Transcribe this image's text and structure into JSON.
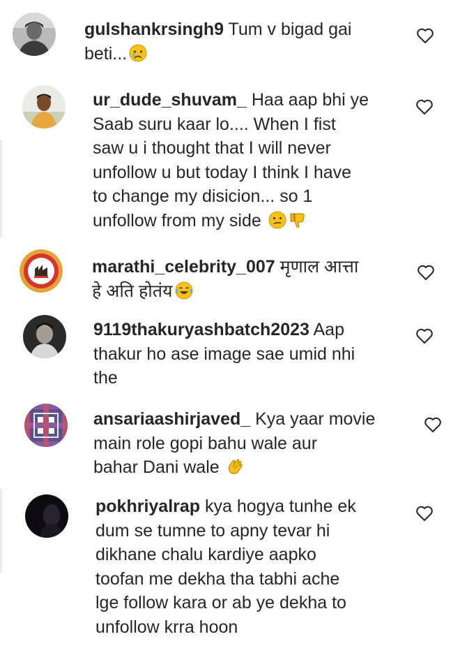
{
  "comments": [
    {
      "username": "gulshankrsingh9",
      "lines": [
        " Tum v bigad gai",
        "beti..."
      ],
      "emojis": [
        "crying-face-icon"
      ]
    },
    {
      "username": "ur_dude_shuvam_",
      "lines": [
        " Haa aap bhi ye",
        "Saab suru kaar lo.... When I fist",
        "saw u i thought that I will never",
        "unfollow u but today I think I have",
        "to change my disicion... so 1",
        "unfollow from my side "
      ],
      "emojis": [
        "confused-face-icon",
        "thumbs-down-icon"
      ]
    },
    {
      "username": "marathi_celebrity_007",
      "lines": [
        " मृणाल आत्ता",
        "हे अति होतंय"
      ],
      "emojis": [
        "tears-of-joy-icon"
      ]
    },
    {
      "username": "9119thakuryashbatch2023",
      "lines": [
        " Aap",
        "thakur ho ase image sae umid nhi",
        "the"
      ],
      "emojis": []
    },
    {
      "username": "ansariaashirjaved_",
      "lines": [
        " Kya yaar movie",
        "main role gopi bahu wale aur",
        "bahar Dani wale "
      ],
      "emojis": [
        "clapping-hands-icon"
      ]
    },
    {
      "username": "pokhriyalrap",
      "lines": [
        " kya hogya tunhe ek",
        "dum se tumne to apny tevar hi",
        "dikhane chalu kardiye aapko",
        "toofan me dekha tha tabhi ache",
        "lge follow kara or ab ye dekha to",
        "unfollow krra hoon"
      ],
      "emojis": []
    }
  ],
  "colors": {
    "text": "#262626",
    "heart_stroke": "#262626",
    "emoji_yellow": "#f6c21a",
    "background": "#ffffff"
  }
}
